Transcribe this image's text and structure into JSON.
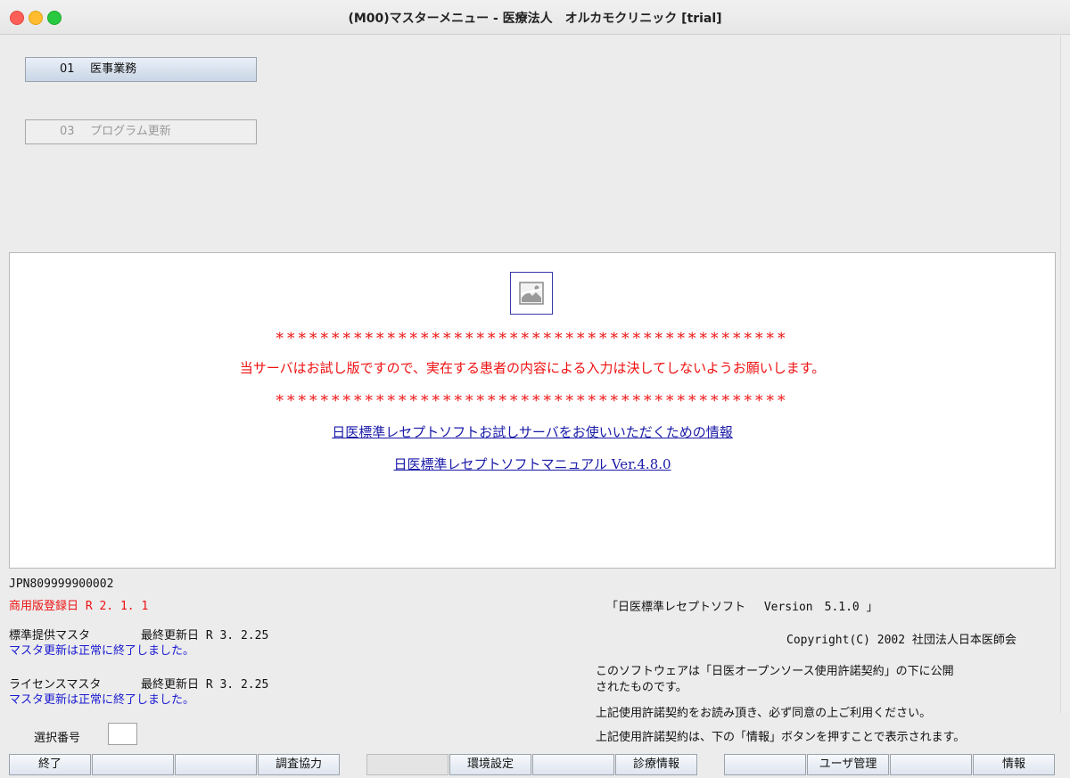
{
  "window": {
    "title": "(M00)マスターメニュー - 医療法人　オルカモクリニック [trial]"
  },
  "menu": {
    "items": [
      {
        "num": "01",
        "label": "医事業務",
        "enabled": true
      },
      {
        "num": "03",
        "label": "プログラム更新",
        "enabled": false
      }
    ]
  },
  "notice": {
    "stars": "**********************************************",
    "warning": "当サーバはお試し版ですので、実在する患者の内容による入力は決してしないようお願いします。",
    "link1": "日医標準レセプトソフトお試しサーバをお使いいただくための情報",
    "link2": "日医標準レセプトソフトマニュアル Ver.4.8.0"
  },
  "status": {
    "jpn_id": "JPN809999900002",
    "commercial_reg": "商用版登録日 R 2. 1. 1",
    "std_master_label": "標準提供マスタ",
    "std_master_date": "最終更新日 R 3. 2.25",
    "std_master_msg": "マスタ更新は正常に終了しました。",
    "license_master_label": "ライセンスマスタ",
    "license_master_date": "最終更新日 R 3. 2.25",
    "license_master_msg": "マスタ更新は正常に終了しました。",
    "version": "「日医標準レセプトソフト　 Version　5.1.0 」",
    "copyright": "Copyright(C) 2002 社団法人日本医師会",
    "license1": "このソフトウェアは「日医オープンソース使用許諾契約」の下に公開",
    "license2": "されたものです。",
    "license3": "上記使用許諾契約をお読み頂き、必ず同意の上ご利用ください。",
    "license4": "上記使用許諾契約は、下の「情報」ボタンを押すことで表示されます。"
  },
  "selection": {
    "label": "選択番号",
    "value": ""
  },
  "function_keys": [
    {
      "label": "終了"
    },
    {
      "label": ""
    },
    {
      "label": ""
    },
    {
      "label": "調査協力"
    },
    {
      "label": ""
    },
    {
      "label": "環境設定"
    },
    {
      "label": ""
    },
    {
      "label": "診療情報"
    },
    {
      "label": ""
    },
    {
      "label": "ユーザ管理"
    },
    {
      "label": ""
    },
    {
      "label": "情報"
    }
  ]
}
